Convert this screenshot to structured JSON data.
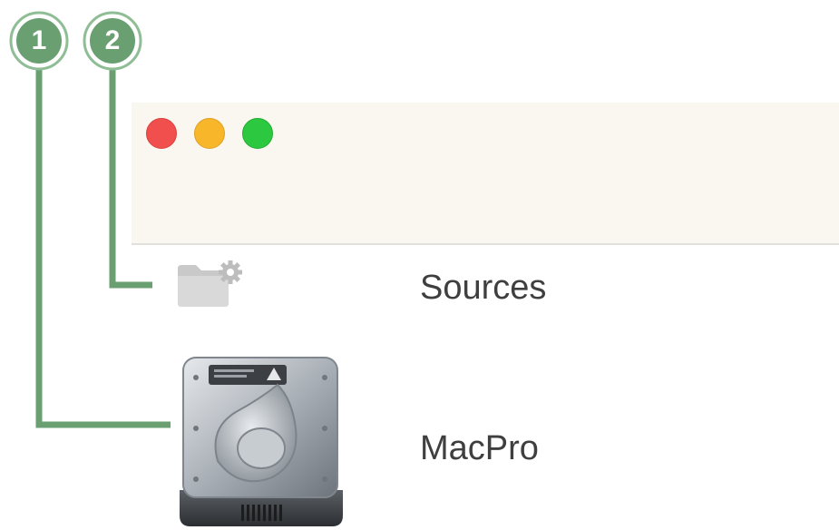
{
  "window": {
    "controls": [
      "close",
      "minimize",
      "zoom"
    ],
    "colors": {
      "close": "#f04f4d",
      "minimize": "#f8b62b",
      "zoom": "#2cc840"
    }
  },
  "callouts": [
    {
      "number": "1",
      "target": "macpro-disk-icon"
    },
    {
      "number": "2",
      "target": "sources-folder-icon"
    }
  ],
  "callout_color": "#6a9f72",
  "items": [
    {
      "label": "Sources",
      "icon": "folder-gear-icon"
    },
    {
      "label": "MacPro",
      "icon": "hard-drive-icon"
    }
  ]
}
